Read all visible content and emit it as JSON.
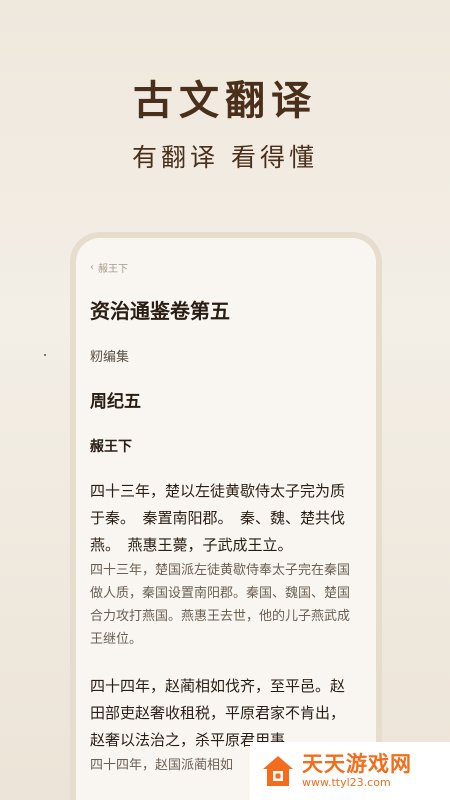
{
  "hero": {
    "title": "古文翻译",
    "subtitle": "有翻译 看得懂"
  },
  "reader": {
    "back_label": "赧王下",
    "book_title": "资治通鉴卷第五",
    "editor": "籾编集",
    "chapter": "周纪五",
    "section": "赧王下",
    "paragraphs": [
      {
        "original": "四十三年，楚以左徒黄歇侍太子完为质于秦。　秦置南阳郡。　秦、魏、楚共伐燕。　燕惠王薨，子武成王立。",
        "translation": "四十三年，楚国派左徒黄歇侍奉太子完在秦国做人质，秦国设置南阳郡。秦国、魏国、楚国合力攻打燕国。燕惠王去世，他的儿子燕武成王继位。"
      },
      {
        "original": "四十四年，赵蔺相如伐齐，至平邑。赵田部吏赵奢收租税，平原君家不肯出，赵奢以法治之，杀平原君用事",
        "translation": "四十四年，赵国派蔺相如"
      }
    ]
  },
  "watermark": {
    "name": "天天游戏网",
    "url": "www.ttyl23.com"
  },
  "colors": {
    "accent": "#4a2f1a",
    "logo": "#f26e1d"
  }
}
